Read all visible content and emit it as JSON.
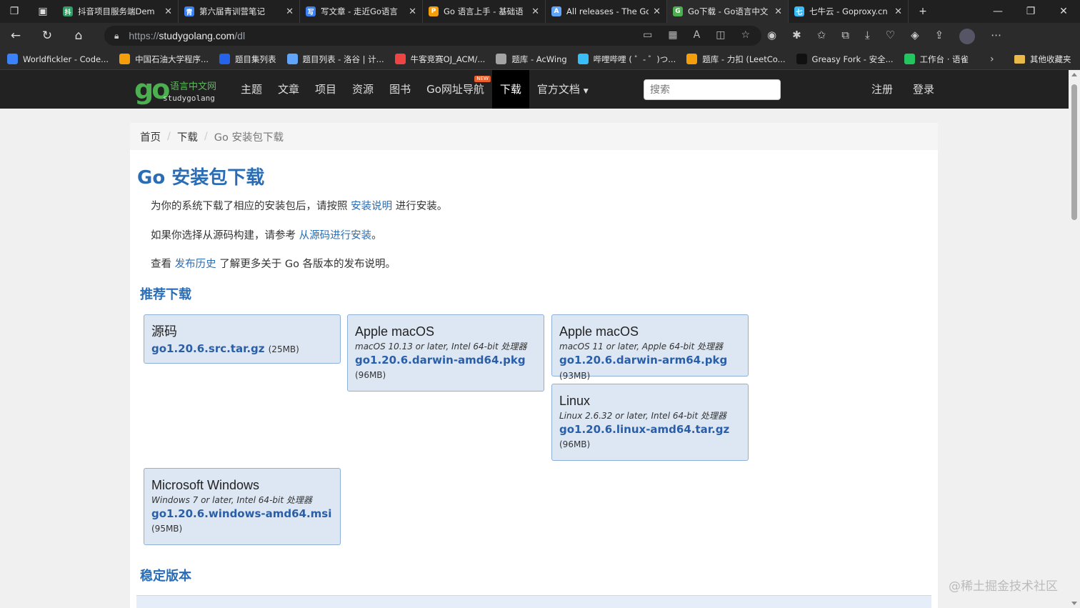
{
  "tabs": [
    {
      "title": "抖音项目服务端Dem",
      "color": "#2f9e63",
      "glyph": "抖"
    },
    {
      "title": "第六届青训营笔记",
      "color": "#3b82f6",
      "glyph": "青"
    },
    {
      "title": "写文章 - 走近Go语言",
      "color": "#3b82f6",
      "glyph": "写"
    },
    {
      "title": "Go 语言上手 - 基础语",
      "color": "#f59e0b",
      "glyph": "P"
    },
    {
      "title": "All releases - The Go",
      "color": "#60a5fa",
      "glyph": "A"
    },
    {
      "title": "Go下载 - Go语言中文",
      "color": "#4caf50",
      "glyph": "G",
      "active": true
    },
    {
      "title": "七牛云 - Goproxy.cn",
      "color": "#38bdf8",
      "glyph": "七"
    }
  ],
  "address": {
    "scheme": "https://",
    "host": "studygolang.com",
    "path": "/dl"
  },
  "bookmarks": [
    {
      "label": "Worldfickler - Code...",
      "color": "#3b82f6"
    },
    {
      "label": "中国石油大学程序...",
      "color": "#f59e0b"
    },
    {
      "label": "题目集列表",
      "color": "#2563eb"
    },
    {
      "label": "题目列表 - 洛谷 | 计...",
      "color": "#60a5fa"
    },
    {
      "label": "牛客竞赛OJ_ACM/...",
      "color": "#ef4444"
    },
    {
      "label": "题库 - AcWing",
      "color": "#a3a3a3"
    },
    {
      "label": "哔哩哔哩 ( ゜- ゜)つ...",
      "color": "#38bdf8"
    },
    {
      "label": "题库 - 力扣 (LeetCo...",
      "color": "#f59e0b"
    },
    {
      "label": "Greasy Fork - 安全...",
      "color": "#111111"
    },
    {
      "label": "工作台 · 语雀",
      "color": "#22c55e"
    }
  ],
  "bookmarks_other": "其他收藏夹",
  "site": {
    "logo_go": "go",
    "logo_cn": "语言中文网",
    "logo_en": "studygolang",
    "menu": [
      "主题",
      "文章",
      "项目",
      "资源",
      "图书",
      "Go网址导航",
      "下载",
      "官方文档"
    ],
    "new_badge": "NEW",
    "search_placeholder": "搜索",
    "register": "注册",
    "login": "登录"
  },
  "breadcrumb": {
    "home": "首页",
    "download": "下载",
    "current": "Go 安装包下载"
  },
  "page_title": "Go 安装包下载",
  "p1": {
    "before": "为你的系统下载了相应的安装包后，请按照 ",
    "link": "安装说明",
    "after": " 进行安装。"
  },
  "p2": {
    "before": "如果你选择从源码构建，请参考 ",
    "link": "从源码进行安装",
    "after": "。"
  },
  "p3": {
    "before": "查看 ",
    "link": "发布历史",
    "after": " 了解更多关于 Go 各版本的发布说明。"
  },
  "recommended_title": "推荐下载",
  "cards": {
    "src": {
      "os": "源码",
      "req": "",
      "file": "go1.20.6.src.tar.gz",
      "size": "(25MB)"
    },
    "mac_amd": {
      "os": "Apple macOS",
      "req": "macOS 10.13 or later, Intel 64-bit 处理器",
      "file": "go1.20.6.darwin-amd64.pkg",
      "size": "(96MB)"
    },
    "mac_arm": {
      "os": "Apple macOS",
      "req": "macOS 11 or later, Apple 64-bit 处理器",
      "file": "go1.20.6.darwin-arm64.pkg",
      "size": "(93MB)"
    },
    "linux": {
      "os": "Linux",
      "req": "Linux 2.6.32 or later, Intel 64-bit 处理器",
      "file": "go1.20.6.linux-amd64.tar.gz",
      "size": "(96MB)"
    },
    "windows": {
      "os": "Microsoft Windows",
      "req": "Windows 7 or later, Intel 64-bit 处理器",
      "file": "go1.20.6.windows-amd64.msi",
      "size": "(95MB)"
    }
  },
  "stable_title": "稳定版本",
  "watermark": "@稀土掘金技术社区"
}
